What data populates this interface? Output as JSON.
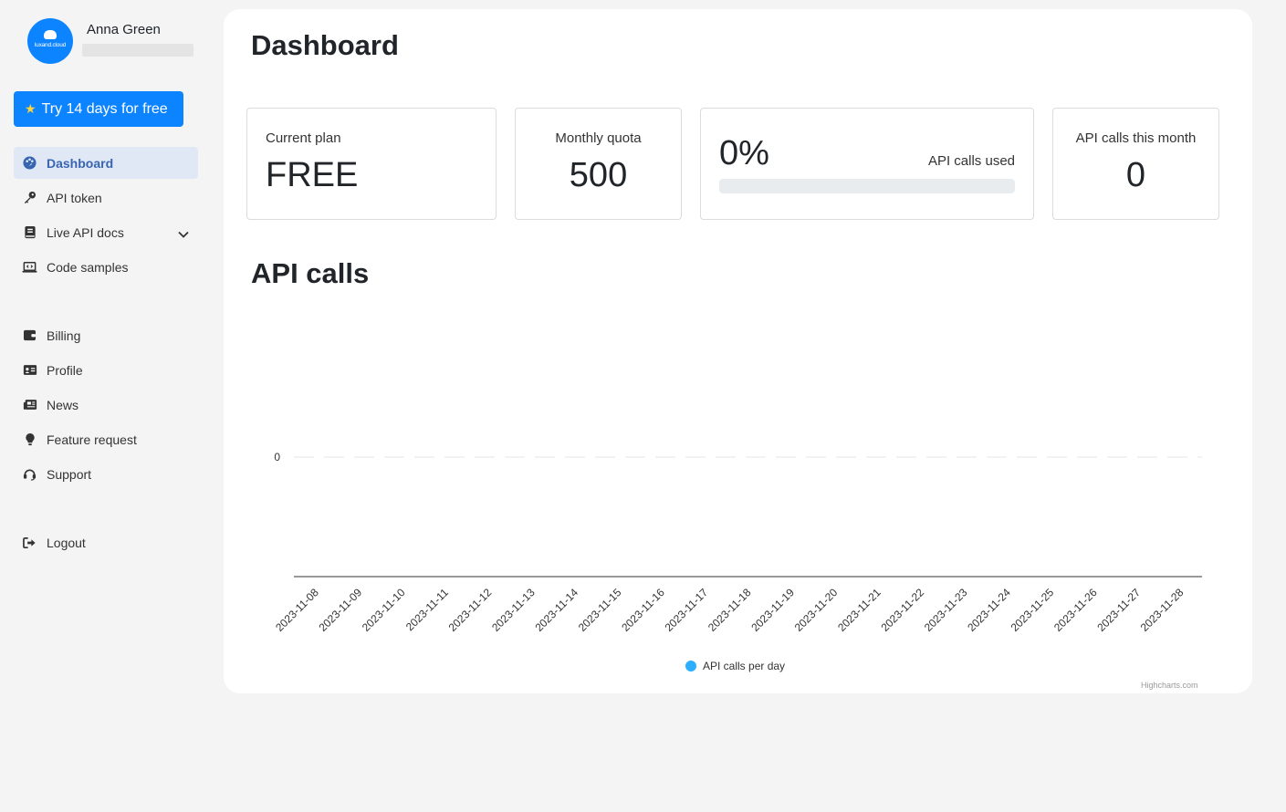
{
  "user": {
    "name": "Anna Green",
    "brand": "luxand.cloud"
  },
  "trial_button": {
    "label": "Try 14 days for free"
  },
  "nav": {
    "items": [
      {
        "label": "Dashboard",
        "icon": "palette-icon"
      },
      {
        "label": "API token",
        "icon": "key-icon"
      },
      {
        "label": "Live API docs",
        "icon": "book-icon"
      },
      {
        "label": "Code samples",
        "icon": "laptop-code-icon"
      },
      {
        "label": "Billing",
        "icon": "wallet-icon"
      },
      {
        "label": "Profile",
        "icon": "id-card-icon"
      },
      {
        "label": "News",
        "icon": "newspaper-icon"
      },
      {
        "label": "Feature request",
        "icon": "lightbulb-icon"
      },
      {
        "label": "Support",
        "icon": "headset-icon"
      },
      {
        "label": "Logout",
        "icon": "sign-out-icon"
      }
    ]
  },
  "page": {
    "title": "Dashboard"
  },
  "stats": {
    "current_plan": {
      "label": "Current plan",
      "value": "FREE"
    },
    "monthly_quota": {
      "label": "Monthly quota",
      "value": "500"
    },
    "usage": {
      "value": "0%",
      "label": "API calls used",
      "progress": 0
    },
    "calls_month": {
      "label": "API calls this month",
      "value": "0"
    }
  },
  "section": {
    "title": "API calls"
  },
  "colors": {
    "accent": "#0d84ff",
    "series": "#2caffe",
    "active_bg": "#e1e8f5",
    "active_text": "#3865b0"
  },
  "chart_data": {
    "type": "line",
    "categories": [
      "2023-11-08",
      "2023-11-09",
      "2023-11-10",
      "2023-11-11",
      "2023-11-12",
      "2023-11-13",
      "2023-11-14",
      "2023-11-15",
      "2023-11-16",
      "2023-11-17",
      "2023-11-18",
      "2023-11-19",
      "2023-11-20",
      "2023-11-21",
      "2023-11-22",
      "2023-11-23",
      "2023-11-24",
      "2023-11-25",
      "2023-11-26",
      "2023-11-27",
      "2023-11-28"
    ],
    "series": [
      {
        "name": "API calls per day",
        "values": [
          0,
          0,
          0,
          0,
          0,
          0,
          0,
          0,
          0,
          0,
          0,
          0,
          0,
          0,
          0,
          0,
          0,
          0,
          0,
          0,
          0
        ]
      }
    ],
    "y_ticks": [
      "0"
    ],
    "legend": "bottom-center",
    "credits": "Highcharts.com"
  }
}
